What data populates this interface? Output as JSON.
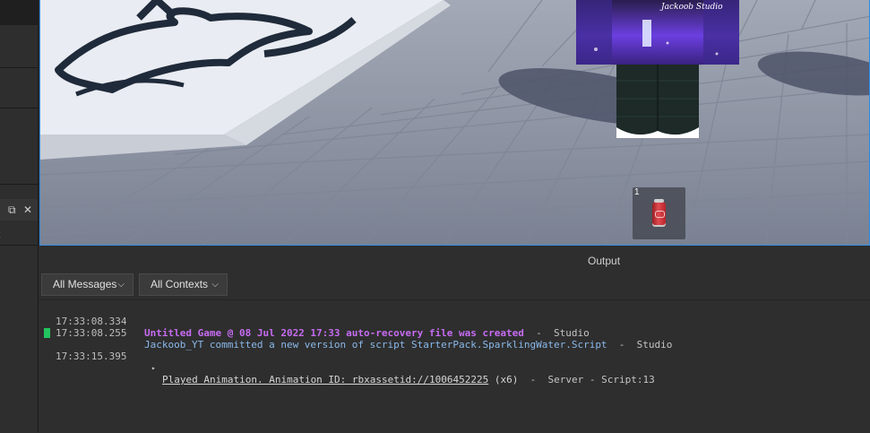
{
  "left_dock": {
    "restore_glyph": "⧉",
    "close_glyph": "✕",
    "cut_text": "t"
  },
  "viewport": {
    "hotbar_slot_number": "1",
    "hotbar_item": "sparkling-water-can-icon",
    "sign_text": "Jackoob Studio"
  },
  "output": {
    "title": "Output",
    "filters": [
      {
        "label": "All Messages",
        "chevron": "⌵"
      },
      {
        "label": "All Contexts",
        "chevron": "⌵"
      }
    ],
    "logs": [
      {
        "time": "17:33:08.334",
        "message": "Untitled Game @ 08 Jul 2022 17:33 auto-recovery file was created",
        "source": "  -  Studio",
        "style": "purple"
      },
      {
        "time": "17:33:08.255",
        "message": "Jackoob_YT committed a new version of script StarterPack.SparklingWater.Script",
        "source": "  -  Studio",
        "style": "blue"
      },
      {
        "time": "17:33:15.395",
        "message": "Played Animation. Animation ID: rbxassetid://1006452225",
        "count": " (x6)",
        "source": "  -  Server - Script:13",
        "style": "white",
        "expander": "▸",
        "marker_color": "#22c55e"
      }
    ]
  },
  "colors": {
    "accent_border": "#2f8ce0",
    "panel_bg": "#2e2e2e"
  }
}
